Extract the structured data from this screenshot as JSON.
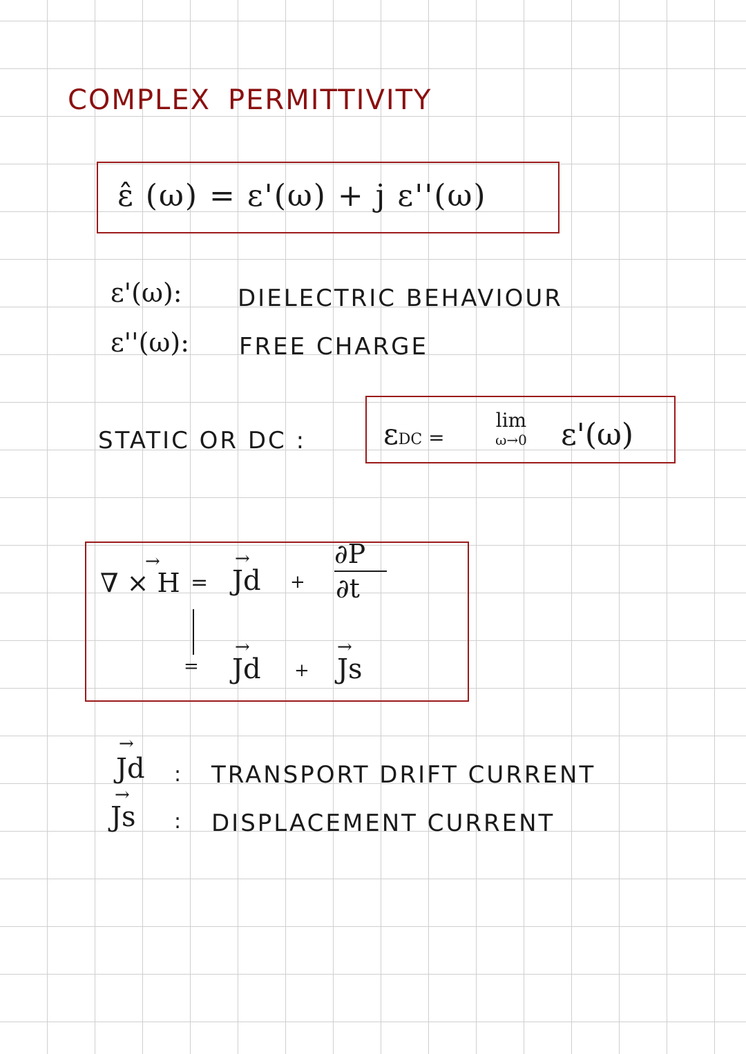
{
  "title": {
    "word1": "COMPLEX",
    "word2": "PERMITTIVITY"
  },
  "eq_main": "ε̂ (ω)  =  ε'(ω) + j ε''(ω)",
  "defs": [
    {
      "sym": "ε'(ω):",
      "text": "DIELECTRIC  BEHAVIOUR"
    },
    {
      "sym": "ε''(ω):",
      "text": "FREE  CHARGE"
    }
  ],
  "static": {
    "label": "STATIC  OR  DC :",
    "lhs": "ε",
    "lhs_sub": "DC",
    "lim_top": "lim",
    "lim_bottom": "ω→0",
    "rhs": "ε'(ω)"
  },
  "maxwell": {
    "lhs": "∇ × H",
    "eq": "=",
    "jd": "Jd",
    "plus": "+",
    "dP": "∂P",
    "dt": "∂t",
    "line2_jd": "Jd",
    "line2_plus": "+",
    "line2_js": "Js"
  },
  "currents": [
    {
      "sym": "Jd",
      "text": "TRANSPORT  DRIFT  CURRENT"
    },
    {
      "sym": "Js",
      "text": "DISPLACEMENT  CURRENT"
    }
  ]
}
